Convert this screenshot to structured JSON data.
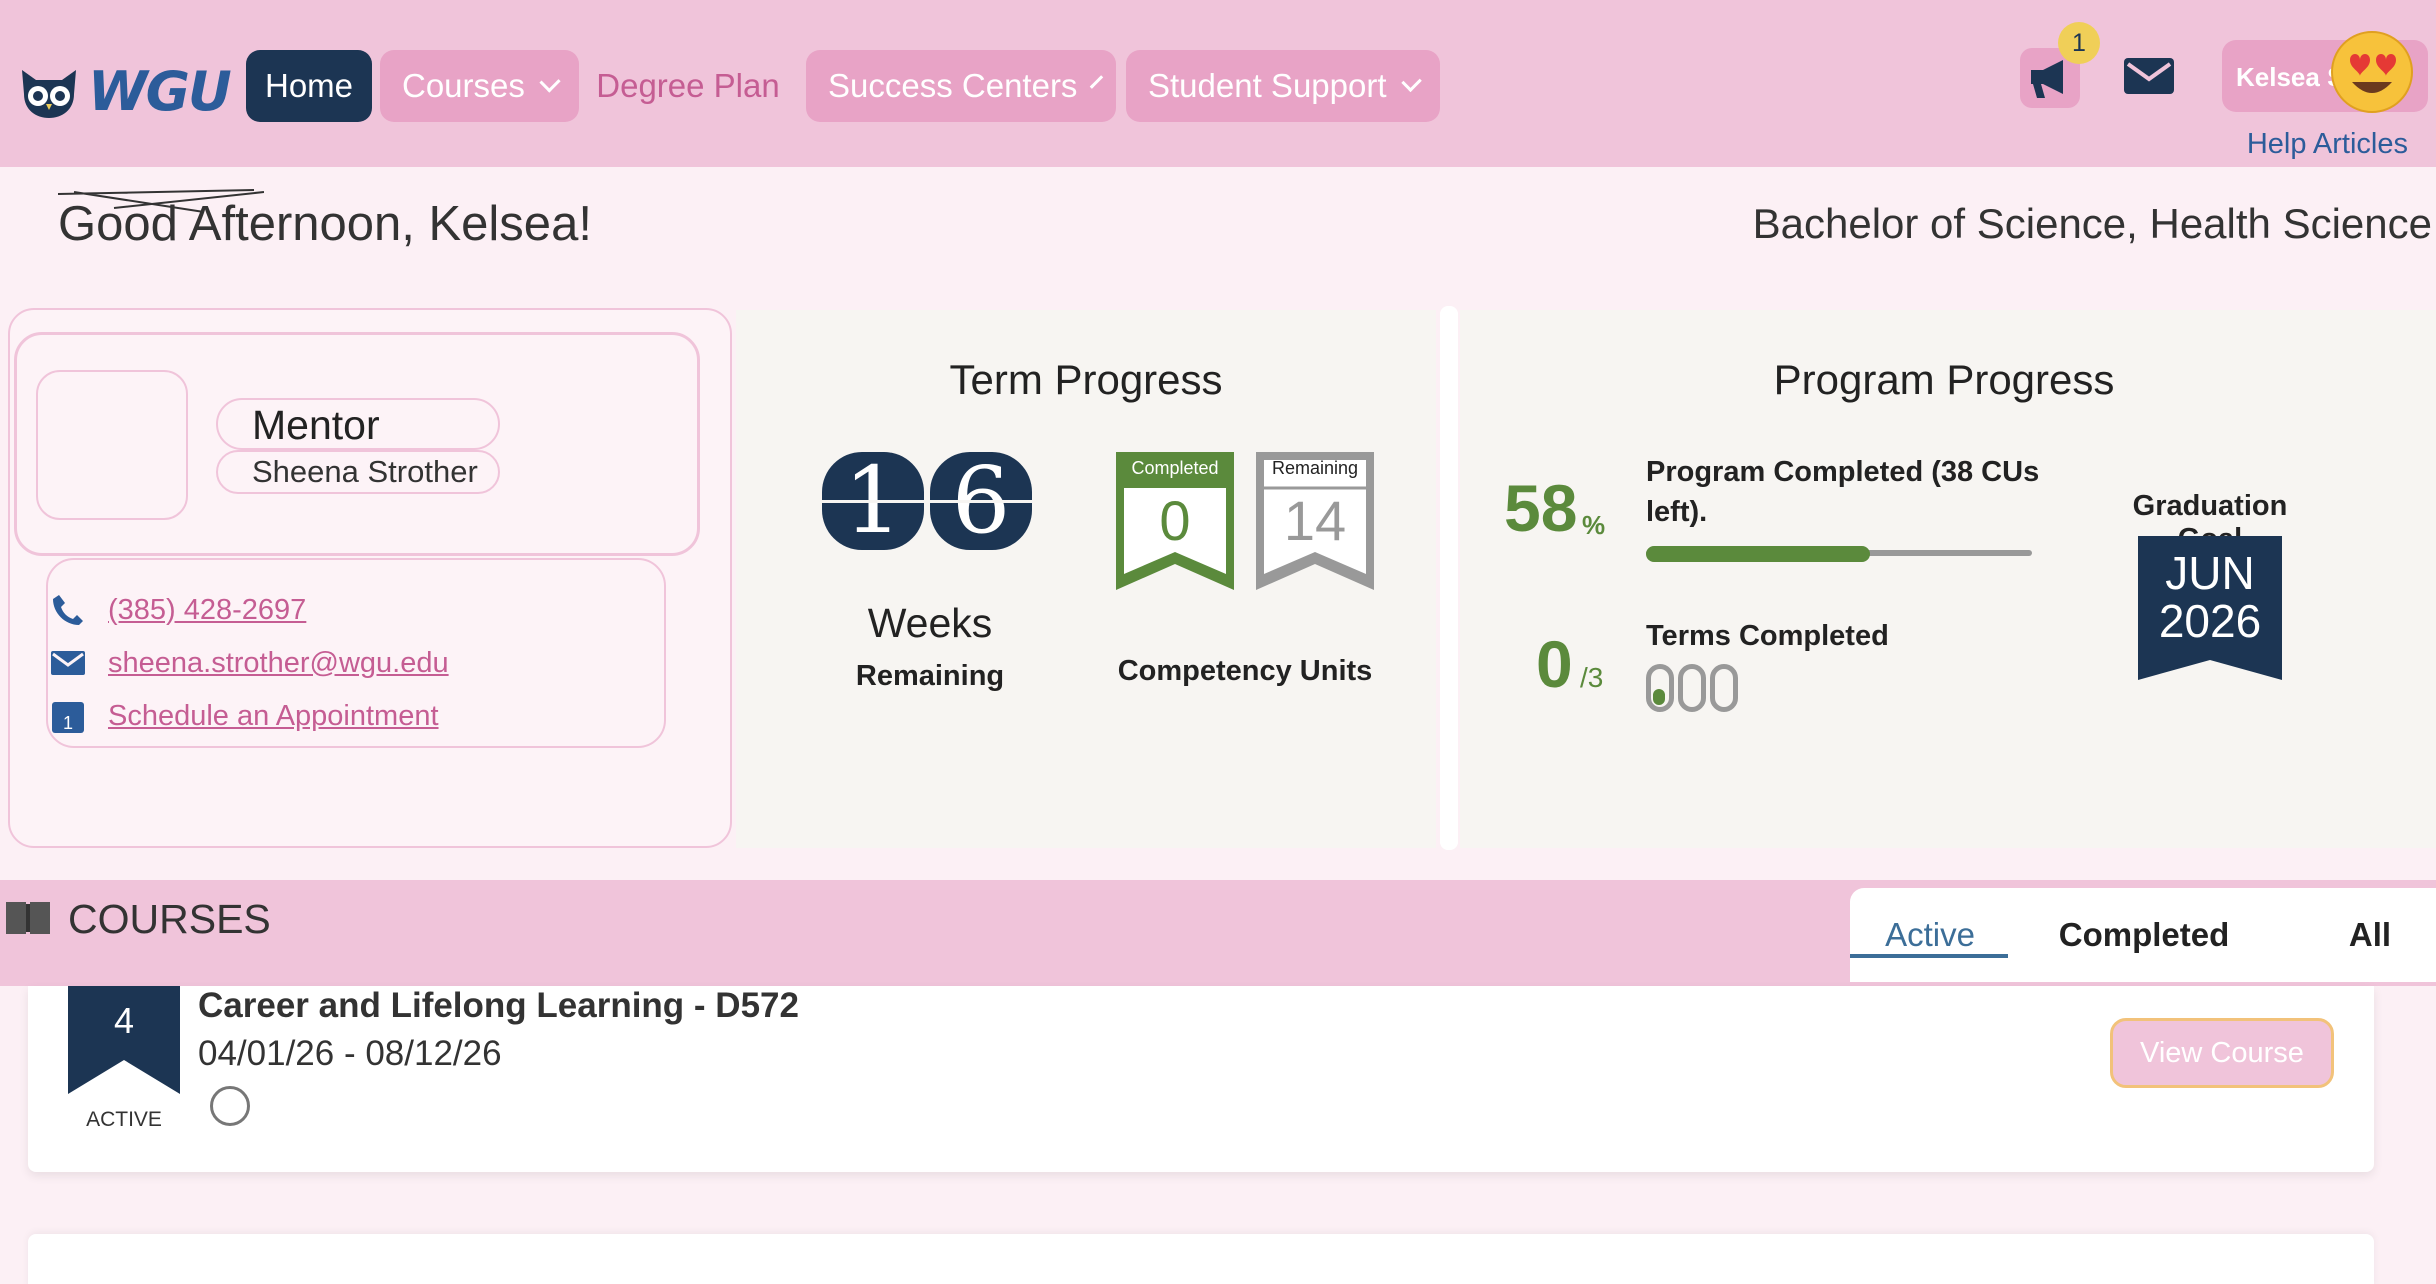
{
  "header": {
    "logo_text": "WGU",
    "nav": {
      "home": "Home",
      "courses": "Courses",
      "degree_plan": "Degree Plan",
      "success_centers": "Success Centers",
      "student_support": "Student Support"
    },
    "notification_count": "1",
    "user_name": "Kelsea S",
    "help_link": "Help Articles"
  },
  "greeting": "Good Afternoon, Kelsea!",
  "degree_program": "Bachelor of Science, Health Science",
  "mentor": {
    "title": "Mentor",
    "name": "Sheena Strother",
    "phone": "(385) 428-2697",
    "email": "sheena.strother@wgu.edu",
    "appointment": "Schedule an Appointment",
    "calendar_day": "1"
  },
  "term_progress": {
    "title": "Term Progress",
    "weeks_digit_1": "1",
    "weeks_digit_2": "6",
    "weeks_label": "Weeks",
    "weeks_sublabel": "Remaining",
    "completed_label": "Completed",
    "completed_value": "0",
    "remaining_label": "Remaining",
    "remaining_value": "14",
    "units_label": "Competency Units"
  },
  "program_progress": {
    "title": "Program Progress",
    "percent_value": "58",
    "percent_symbol": "%",
    "percent_fraction": 0.58,
    "completed_text": "Program Completed (38 CUs left).",
    "terms_completed": "0",
    "terms_total": "/3",
    "terms_label": "Terms Completed",
    "graduation_label": "Graduation Goal",
    "graduation_month": "JUN",
    "graduation_year": "2026"
  },
  "courses": {
    "section_title": "COURSES",
    "tabs": {
      "active": "Active",
      "completed": "Completed",
      "all": "All"
    },
    "items": [
      {
        "cu": "4",
        "status": "ACTIVE",
        "title": "Career and Lifelong Learning - D572",
        "dates": "04/01/26 - 08/12/26",
        "button": "View Course"
      }
    ]
  },
  "colors": {
    "navy": "#1c3553",
    "pink": "#e8a3c6",
    "light_pink": "#f0c4da",
    "green": "#5b8a3c",
    "link_blue": "#2c5c9a"
  },
  "icons": [
    "owl-logo-icon",
    "chevron-down-icon",
    "megaphone-icon",
    "mail-icon",
    "heart-eyes-emoji-icon",
    "phone-icon",
    "email-icon",
    "calendar-icon",
    "book-icon",
    "circle-icon"
  ]
}
